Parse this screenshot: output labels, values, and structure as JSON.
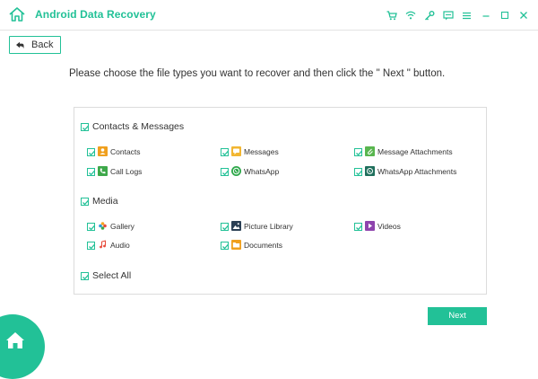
{
  "titlebar": {
    "app_title": "Android Data Recovery",
    "icons": [
      "cart-icon",
      "wifi-icon",
      "key-icon",
      "chat-icon",
      "menu-icon",
      "minimize-icon",
      "maximize-icon",
      "close-icon"
    ]
  },
  "back": {
    "label": "Back"
  },
  "instruction": "Please choose the file types you want to recover and then click the \" Next \" button.",
  "groups": {
    "contacts_messages": {
      "label": "Contacts & Messages",
      "checked": true,
      "items": [
        {
          "label": "Contacts",
          "icon": "contacts-icon",
          "color": "#f0a01e",
          "checked": true
        },
        {
          "label": "Messages",
          "icon": "messages-icon",
          "color": "#f2b632",
          "checked": true
        },
        {
          "label": "Message Attachments",
          "icon": "message-attachments-icon",
          "color": "#59b64f",
          "checked": true
        },
        {
          "label": "Call Logs",
          "icon": "call-logs-icon",
          "color": "#3ea84a",
          "checked": true
        },
        {
          "label": "WhatsApp",
          "icon": "whatsapp-icon",
          "color": "#2fa84b",
          "checked": true
        },
        {
          "label": "WhatsApp Attachments",
          "icon": "whatsapp-attachments-icon",
          "color": "#1f6f5c",
          "checked": true
        }
      ]
    },
    "media": {
      "label": "Media",
      "checked": true,
      "items": [
        {
          "label": "Gallery",
          "icon": "gallery-icon",
          "color": "#f5a623",
          "checked": true
        },
        {
          "label": "Picture Library",
          "icon": "picture-library-icon",
          "color": "#2a3f54",
          "checked": true
        },
        {
          "label": "Videos",
          "icon": "videos-icon",
          "color": "#8e44ad",
          "checked": true
        },
        {
          "label": "Audio",
          "icon": "audio-icon",
          "color": "#e74c3c",
          "checked": true
        },
        {
          "label": "Documents",
          "icon": "documents-icon",
          "color": "#f0a01e",
          "checked": true
        }
      ]
    }
  },
  "select_all": {
    "label": "Select All",
    "checked": true
  },
  "next": {
    "label": "Next"
  },
  "colors": {
    "accent": "#22c197",
    "text": "#333333",
    "border": "#dcdcdc"
  }
}
